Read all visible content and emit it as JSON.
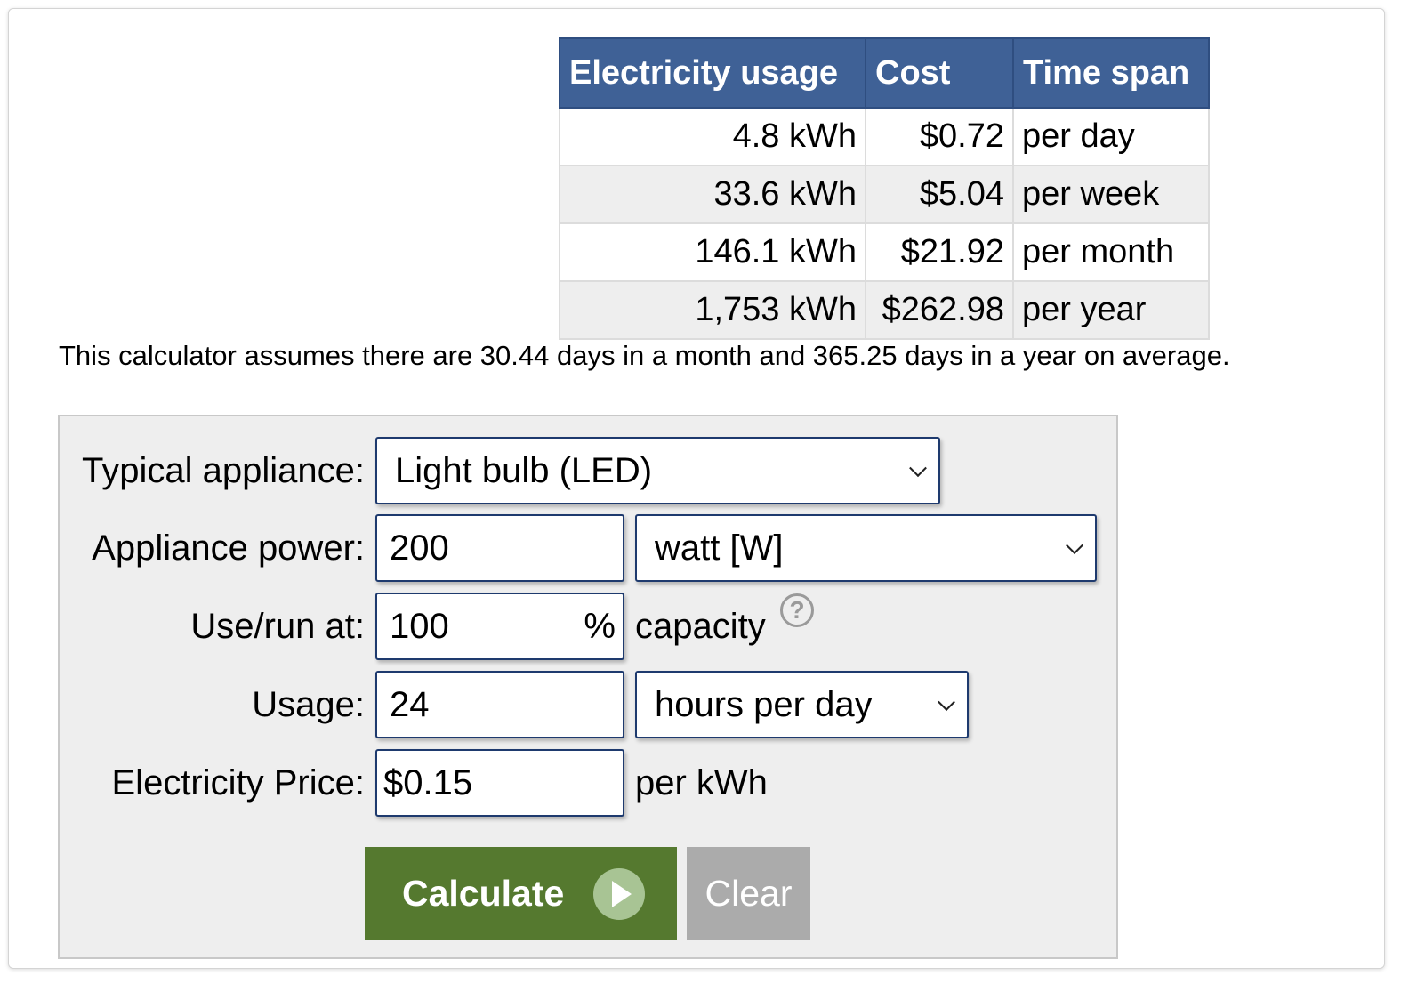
{
  "results_table": {
    "headers": [
      "Electricity usage",
      "Cost",
      "Time span"
    ],
    "rows": [
      {
        "usage": "4.8 kWh",
        "cost": "$0.72",
        "span": "per day"
      },
      {
        "usage": "33.6 kWh",
        "cost": "$5.04",
        "span": "per week"
      },
      {
        "usage": "146.1 kWh",
        "cost": "$21.92",
        "span": "per month"
      },
      {
        "usage": "1,753 kWh",
        "cost": "$262.98",
        "span": "per year"
      }
    ]
  },
  "note": "This calculator assumes there are 30.44 days in a month and 365.25 days in a year on average.",
  "form": {
    "appliance_label": "Typical appliance:",
    "appliance_value": "Light bulb (LED)",
    "power_label": "Appliance power:",
    "power_value": "200",
    "power_unit": "watt [W]",
    "userun_label": "Use/run at:",
    "userun_value": "100",
    "userun_pct": "%",
    "userun_suffix": "capacity",
    "help_glyph": "?",
    "usage_label": "Usage:",
    "usage_value": "24",
    "usage_unit": "hours per day",
    "price_label": "Electricity Price:",
    "price_value": "$0.15",
    "price_suffix": "per kWh"
  },
  "buttons": {
    "calculate": "Calculate",
    "clear": "Clear"
  },
  "colors": {
    "table_header": "#3f6196",
    "calculate_button": "#55792f",
    "clear_button": "#ababab"
  }
}
